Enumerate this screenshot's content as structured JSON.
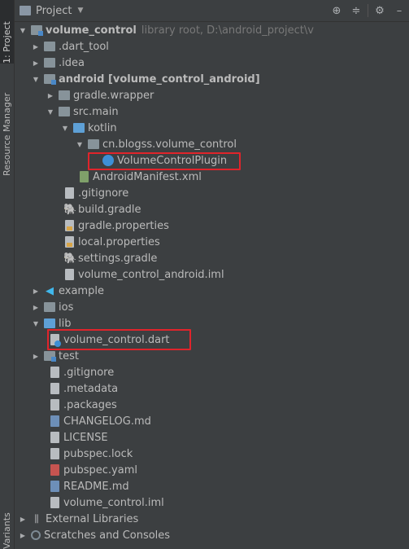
{
  "side_tabs": {
    "project": "1: Project",
    "resource_manager": "Resource Manager",
    "variants": "Variants"
  },
  "header": {
    "title": "Project"
  },
  "root": {
    "name": "volume_control",
    "hint": "library root,  D:\\android_project\\v"
  },
  "items": {
    "dart_tool": ".dart_tool",
    "idea": ".idea",
    "android": "android [volume_control_android]",
    "gradle_wrapper": "gradle.wrapper",
    "src_main": "src.main",
    "kotlin": "kotlin",
    "package": "cn.blogss.volume_control",
    "plugin": "VolumeControlPlugin",
    "manifest": "AndroidManifest.xml",
    "android_gitignore": ".gitignore",
    "build_gradle": "build.gradle",
    "gradle_properties": "gradle.properties",
    "local_properties": "local.properties",
    "settings_gradle": "settings.gradle",
    "android_iml": "volume_control_android.iml",
    "example": "example",
    "ios": "ios",
    "lib": "lib",
    "dart_file": "volume_control.dart",
    "test": "test",
    "gitignore": ".gitignore",
    "metadata": ".metadata",
    "packages": ".packages",
    "changelog": "CHANGELOG.md",
    "license": "LICENSE",
    "pubspec_lock": "pubspec.lock",
    "pubspec_yaml": "pubspec.yaml",
    "readme": "README.md",
    "root_iml": "volume_control.iml",
    "external_libraries": "External Libraries",
    "scratches": "Scratches and Consoles"
  },
  "colors": {
    "panel_bg": "#3c3f41",
    "highlight_border": "#e0242b",
    "folder_blue": "#5ea0d6"
  }
}
